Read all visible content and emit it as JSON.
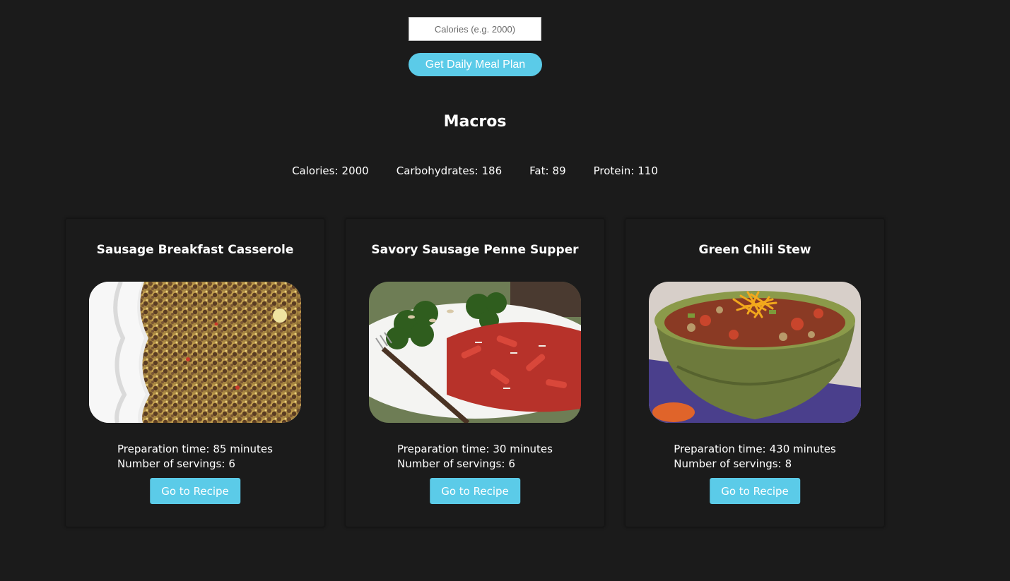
{
  "search": {
    "placeholder": "Calories (e.g. 2000)",
    "button_label": "Get Daily Meal Plan"
  },
  "macros": {
    "title": "Macros",
    "items": [
      {
        "label": "Calories:",
        "value": "2000"
      },
      {
        "label": "Carbohydrates:",
        "value": "186"
      },
      {
        "label": "Fat:",
        "value": "89"
      },
      {
        "label": "Protein:",
        "value": "110"
      }
    ]
  },
  "meals": [
    {
      "title": "Sausage Breakfast Casserole",
      "prep_label": "Preparation time:",
      "prep_value": "85 minutes",
      "servings_label": "Number of servings:",
      "servings_value": "6",
      "button_label": "Go to Recipe",
      "image_icon": "casserole-photo"
    },
    {
      "title": "Savory Sausage Penne Supper",
      "prep_label": "Preparation time:",
      "prep_value": "30 minutes",
      "servings_label": "Number of servings:",
      "servings_value": "6",
      "button_label": "Go to Recipe",
      "image_icon": "penne-photo"
    },
    {
      "title": "Green Chili Stew",
      "prep_label": "Preparation time:",
      "prep_value": "430 minutes",
      "servings_label": "Number of servings:",
      "servings_value": "8",
      "button_label": "Go to Recipe",
      "image_icon": "stew-photo"
    }
  ],
  "colors": {
    "background": "#1b1b1b",
    "accent": "#5bcbe8",
    "text": "#ffffff"
  }
}
